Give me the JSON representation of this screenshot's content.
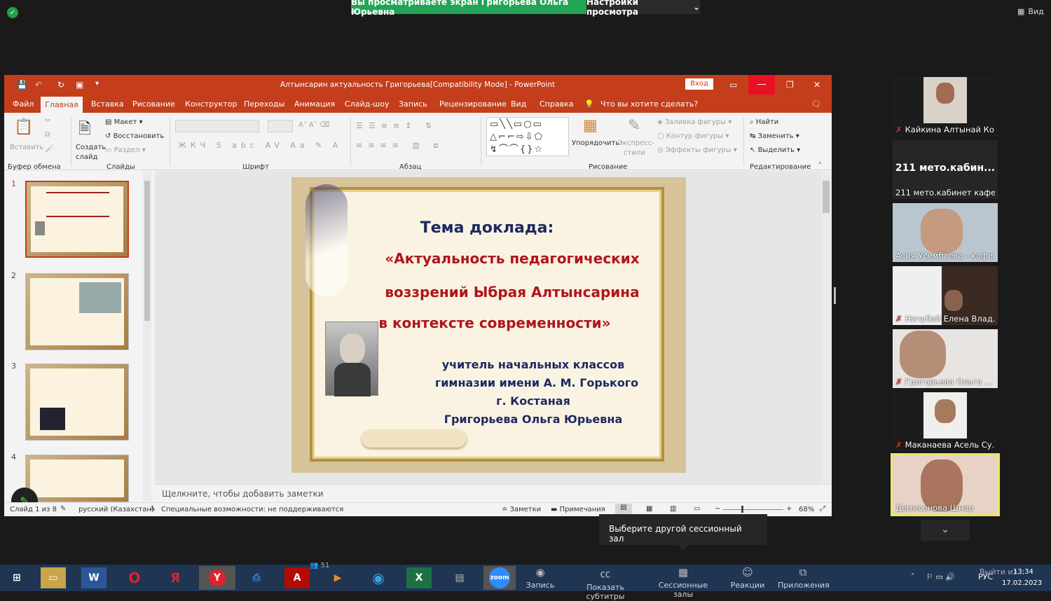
{
  "zoom": {
    "share_banner": "Вы просматриваете экран Григорьева  Ольга  Юрьевна",
    "view_options": "Настройки просмотра",
    "view": "Вид",
    "tooltip": "Выберите другой сессионный зал",
    "participants": [
      {
        "name": "Кайкина Алтынай Ко...",
        "muted": true
      },
      {
        "name": "211 мето.кабинет кафед...",
        "label": "211  мето.кабин...",
        "muted": false
      },
      {
        "name": "Асия Усембаева - кафе...",
        "muted": false
      },
      {
        "name": "Ничубай Елена Влад...",
        "muted": true
      },
      {
        "name": "Григорьева  Ольга  ...",
        "muted": true
      },
      {
        "name": "Маканаева Асель Су...",
        "muted": true
      },
      {
        "name": "Демисенова Шнар",
        "muted": false
      }
    ],
    "toolbar": [
      {
        "label": "Запись",
        "icon": "record-icon"
      },
      {
        "label": "Показать субтитры",
        "icon": "cc-icon"
      },
      {
        "label": "Сессионные залы",
        "icon": "breakout-icon"
      },
      {
        "label": "Реакции",
        "icon": "reactions-icon"
      },
      {
        "label": "Приложения",
        "icon": "apps-icon"
      }
    ],
    "participants_count": "51",
    "leave": "Выйти из..."
  },
  "ppt": {
    "title": "Алтынсарин актуальность Григорьева[Compatibility Mode]  -  PowerPoint",
    "sign_in": "Вход",
    "menu": [
      "Файл",
      "Главная",
      "Вставка",
      "Рисование",
      "Конструктор",
      "Переходы",
      "Анимация",
      "Слайд-шоу",
      "Запись",
      "Рецензирование",
      "Вид",
      "Справка"
    ],
    "tell_me": "Что вы хотите сделать?",
    "ribbon": {
      "paste": "Вставить",
      "new_slide": "Создать",
      "new_slide2": "слайд",
      "layout": "Макет",
      "reset": "Восстановить",
      "section": "Раздел",
      "arrange": "Упорядочить",
      "quick_styles": "Экспресс-",
      "quick_styles2": "стили",
      "fill": "Заливка фигуры",
      "outline": "Контур фигуры",
      "effects": "Эффекты фигуры",
      "find": "Найти",
      "replace": "Заменить",
      "select": "Выделить",
      "groups": [
        "Буфер обмена",
        "Слайды",
        "Шрифт",
        "Абзац",
        "Рисование",
        "Редактирование"
      ]
    },
    "slide": {
      "line1": "Тема   доклада:",
      "line2": "«Актуальность  педагогических",
      "line3": "воззрений  Ыбрая   Алтынсарина",
      "line4": "в   контексте   современности»",
      "line5": "учитель  начальных  классов",
      "line6": "гимназии  имени  А. М. Горького",
      "line7": "г.  Костаная",
      "line8": "Григорьева  Ольга  Юрьевна"
    },
    "thumb_numbers": [
      "1",
      "2",
      "3",
      "4"
    ],
    "notes_placeholder": "Щелкните, чтобы добавить заметки",
    "status": {
      "slide": "Слайд 1 из 8",
      "language": "русский (Казахстан)",
      "accessibility": "Специальные возможности: не поддерживаются",
      "notes": "Заметки",
      "comments": "Примечания",
      "zoom": "68%"
    }
  },
  "taskbar": {
    "lang": "РУС",
    "time": "13:34",
    "date": "17.02.2023"
  }
}
